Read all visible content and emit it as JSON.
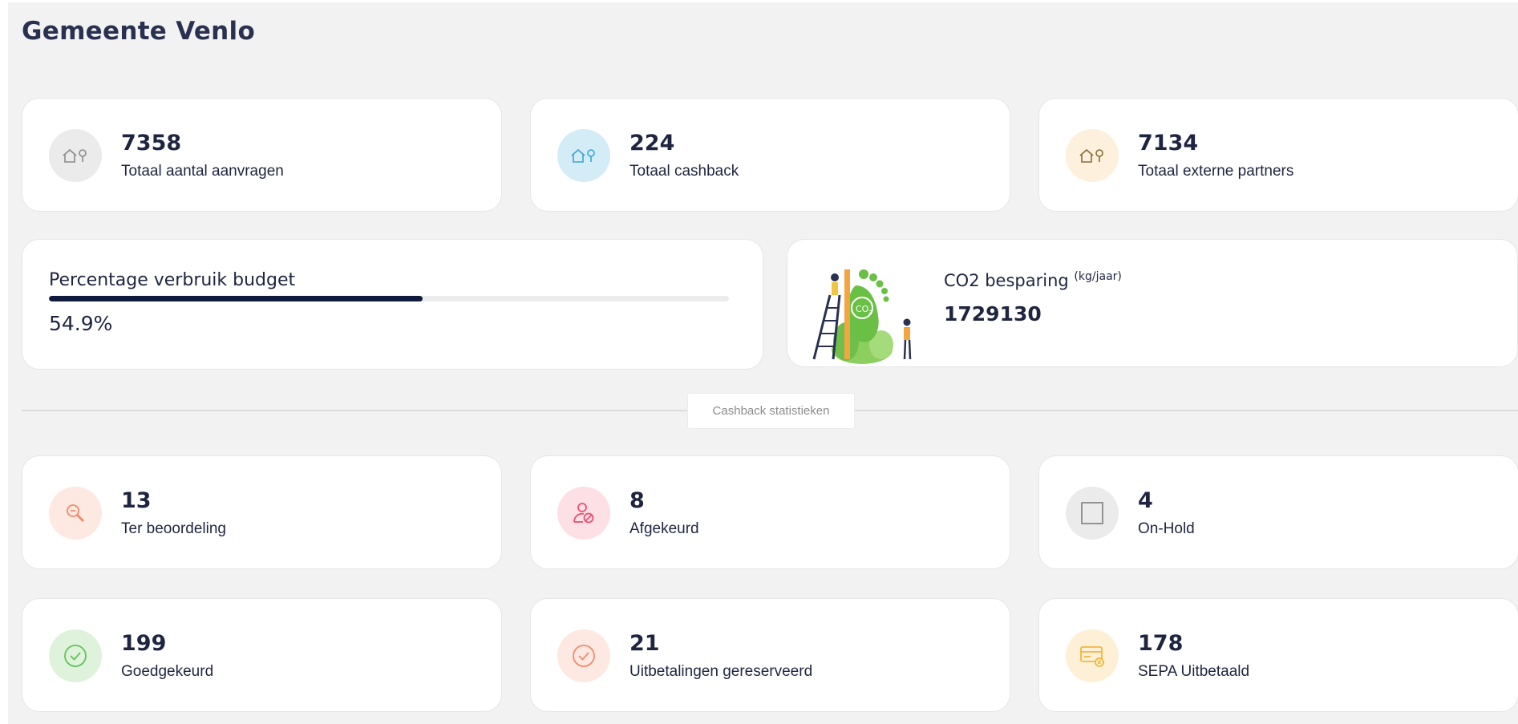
{
  "page": {
    "title": "Gemeente Venlo"
  },
  "summary": [
    {
      "value": "7358",
      "label": "Totaal aantal aanvragen",
      "icon": "house-pin-icon",
      "bg": "#ebebeb",
      "fg": "#8a8a8a"
    },
    {
      "value": "224",
      "label": "Totaal cashback",
      "icon": "house-pin-icon",
      "bg": "#d3ecf6",
      "fg": "#3aa3d8"
    },
    {
      "value": "7134",
      "label": "Totaal externe partners",
      "icon": "house-pin-icon",
      "bg": "#fdf0dc",
      "fg": "#8a6d3b"
    }
  ],
  "budget": {
    "label": "Percentage verbruik budget",
    "value": "54.9%",
    "progress": 0.549,
    "bar_color": "#101a3d"
  },
  "co2": {
    "label": "CO2 besparing",
    "unit": "(kg/jaar)",
    "value": "1729130",
    "illustration": "co2-footprint-illustration"
  },
  "divider": {
    "label": "Cashback statistieken"
  },
  "statuses": [
    {
      "value": "13",
      "label": "Ter beoordeling",
      "icon": "magnifier-icon",
      "bg": "#fde9e1",
      "fg": "#f28b6b"
    },
    {
      "value": "8",
      "label": "Afgekeurd",
      "icon": "user-blocked-icon",
      "bg": "#fde0e6",
      "fg": "#e8506d"
    },
    {
      "value": "4",
      "label": "On-Hold",
      "icon": "square-icon",
      "bg": "#ebebeb",
      "fg": "#8a8a8a"
    },
    {
      "value": "199",
      "label": "Goedgekeurd",
      "icon": "check-circle-icon",
      "bg": "#dff3dc",
      "fg": "#62c25a"
    },
    {
      "value": "21",
      "label": "Uitbetalingen gereserveerd",
      "icon": "check-circle-icon",
      "bg": "#fde9e1",
      "fg": "#f28b6b"
    },
    {
      "value": "178",
      "label": "SEPA Uitbetaald",
      "icon": "euro-card-icon",
      "bg": "#fdf0d6",
      "fg": "#f2b63c"
    }
  ]
}
